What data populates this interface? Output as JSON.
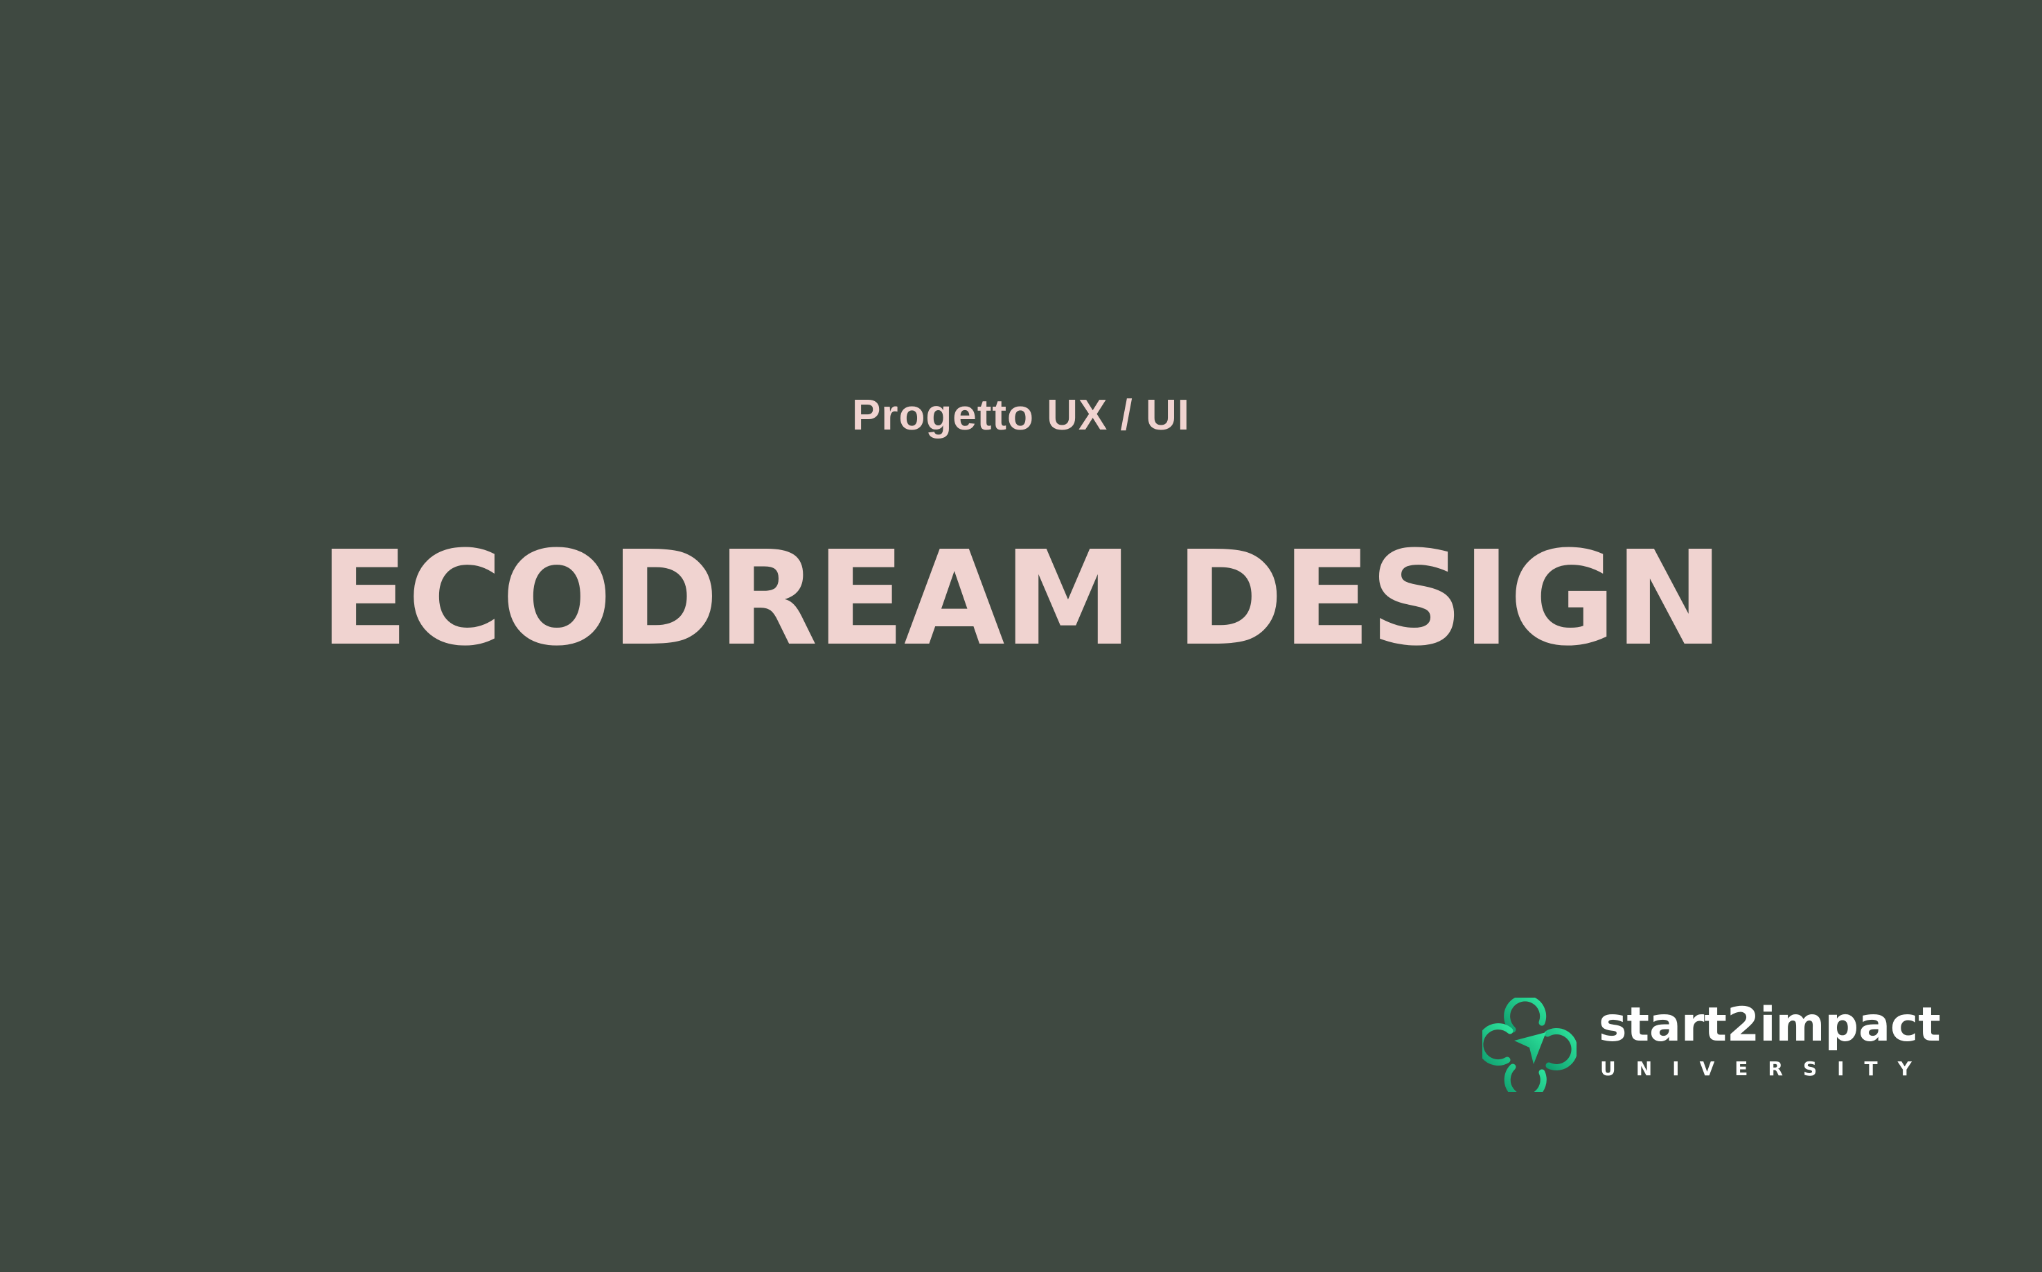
{
  "slide": {
    "subtitle": "Progetto UX / UI",
    "title": "ECODREAM DESIGN",
    "background_color": "#3f4941",
    "text_color": "#f0d3d0"
  },
  "logo": {
    "icon": "start2impact-logo-icon",
    "wordmark": "start2impact",
    "tagline": "UNIVERSITY",
    "accent_color": "#1fc98a"
  }
}
